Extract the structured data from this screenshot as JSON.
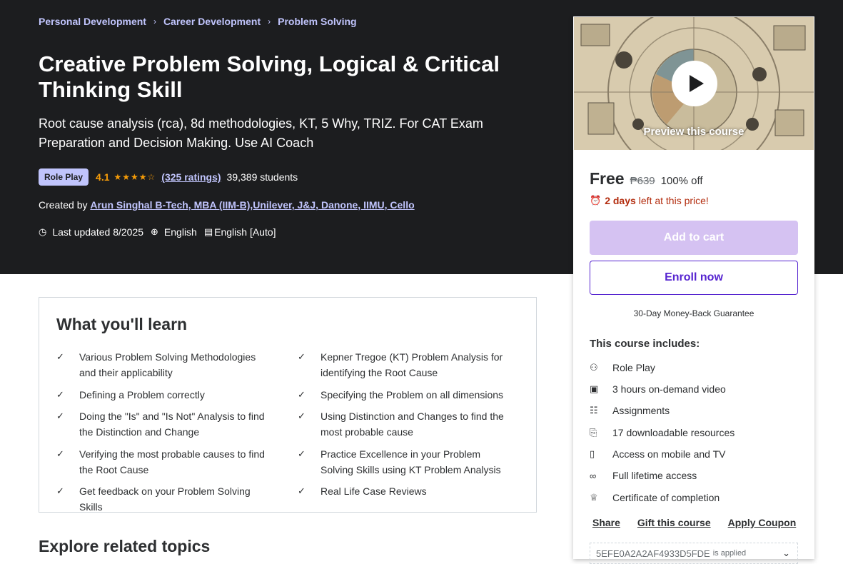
{
  "breadcrumb": [
    "Personal Development",
    "Career Development",
    "Problem Solving"
  ],
  "breadcrumb_sep": "›",
  "title": "Creative Problem Solving, Logical & Critical Thinking Skill",
  "subtitle": "Root cause analysis (rca), 8d methodologies, KT, 5 Why, TRIZ. For CAT Exam Preparation and Decision Making. Use AI Coach",
  "badge": "Role Play",
  "rating": "4.1",
  "stars": "★★★★☆",
  "ratings_count": "(325 ratings)",
  "students": "39,389 students",
  "created_by_label": "Created by",
  "author": "Arun Singhal B-Tech, MBA (IIM-B),Unilever, J&J, Danone, IIMU, Cello",
  "last_updated": "Last updated 8/2025",
  "language": "English",
  "captions": "English [Auto]",
  "learn": {
    "title": "What you'll learn",
    "items_left": [
      "Various Problem Solving Methodologies and their applicability",
      "Defining a Problem correctly",
      "Doing the \"Is\" and \"Is Not\" Analysis to find the Distinction and Change",
      "Verifying the most probable causes to find the Root Cause",
      "Get feedback on your Problem Solving Skills"
    ],
    "items_right": [
      "Kepner Tregoe (KT) Problem Analysis for identifying the Root Cause",
      "Specifying the Problem on all dimensions",
      "Using Distinction and Changes to find the most probable cause",
      "Practice Excellence in your Problem Solving Skills using KT Problem Analysis",
      "Real Life Case Reviews"
    ]
  },
  "explore_title": "Explore related topics",
  "card": {
    "preview_label": "Preview this course",
    "price": "Free",
    "old_price": "₱639",
    "discount": "100% off",
    "timer_bold": "2 days",
    "timer_rest": "left at this price!",
    "add_to_cart": "Add to cart",
    "enroll_now": "Enroll now",
    "guarantee": "30-Day Money-Back Guarantee",
    "includes_title": "This course includes:",
    "includes": [
      {
        "icon": "role-play-icon",
        "label": "Role Play"
      },
      {
        "icon": "video-icon",
        "label": "3 hours on-demand video"
      },
      {
        "icon": "assignment-icon",
        "label": "Assignments"
      },
      {
        "icon": "download-icon",
        "label": "17 downloadable resources"
      },
      {
        "icon": "mobile-icon",
        "label": "Access on mobile and TV"
      },
      {
        "icon": "infinity-icon",
        "label": "Full lifetime access"
      },
      {
        "icon": "trophy-icon",
        "label": "Certificate of completion"
      }
    ],
    "share": "Share",
    "gift": "Gift this course",
    "apply_coupon": "Apply Coupon",
    "coupon_code": "5EFE0A2A2AF4933D5FDE",
    "coupon_applied": "is applied"
  },
  "colors": {
    "hero_bg": "#1c1d1f",
    "accent_link": "#c0c4fc",
    "star": "#f69c08",
    "primary": "#5624d0",
    "cart_disabled": "#d5c2f2",
    "timer_red": "#b32d0f"
  }
}
